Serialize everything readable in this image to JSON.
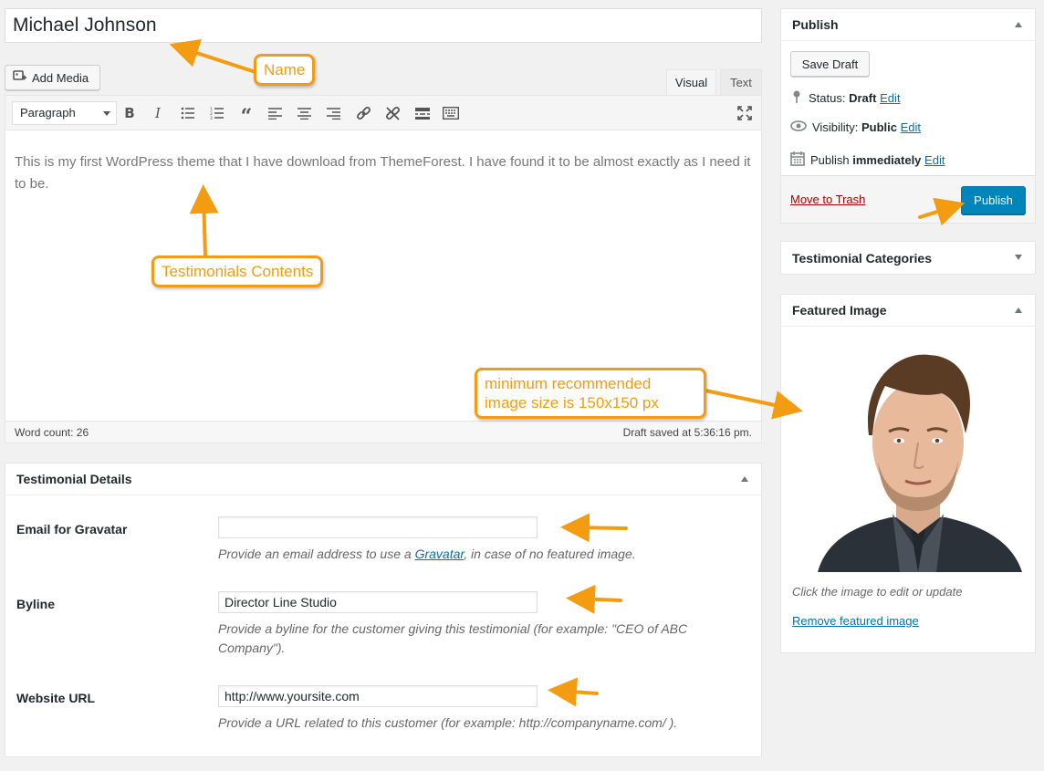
{
  "post": {
    "title": "Michael Johnson",
    "content": "This is my first WordPress theme that I have download from ThemeForest. I have found it to be almost exactly as I need it to be."
  },
  "editor": {
    "add_media_label": "Add Media",
    "tab_visual": "Visual",
    "tab_text": "Text",
    "format_select_value": "Paragraph",
    "toolbar_icons": [
      "bold-icon",
      "italic-icon",
      "bulleted-list-icon",
      "numbered-list-icon",
      "blockquote-icon",
      "align-left-icon",
      "align-center-icon",
      "align-right-icon",
      "link-icon",
      "unlink-icon",
      "read-more-icon",
      "toolbar-toggle-icon",
      "fullscreen-icon"
    ],
    "word_count": "Word count: 26",
    "draft_saved": "Draft saved at 5:36:16 pm."
  },
  "details": {
    "title": "Testimonial Details",
    "email_label": "Email for Gravatar",
    "email_value": "",
    "email_desc_before": "Provide an email address to use a ",
    "email_desc_link": "Gravatar",
    "email_desc_after": ", in case of no featured image.",
    "byline_label": "Byline",
    "byline_value": "Director Line Studio",
    "byline_desc": "Provide a byline for the customer giving this testimonial (for example: \"CEO of ABC Company\").",
    "url_label": "Website URL",
    "url_value": "http://www.yoursite.com",
    "url_desc": "Provide a URL related to this customer (for example: http://companyname.com/ )."
  },
  "publish": {
    "title": "Publish",
    "save_draft": "Save Draft",
    "status_label": "Status:",
    "status_value": "Draft",
    "visibility_label": "Visibility:",
    "visibility_value": "Public",
    "publish_label": "Publish",
    "publish_value": "immediately",
    "edit": "Edit",
    "trash": "Move to Trash",
    "publish_button": "Publish"
  },
  "categories": {
    "title": "Testimonial Categories"
  },
  "featured": {
    "title": "Featured Image",
    "hint": "Click the image to edit or update",
    "remove": "Remove featured image"
  },
  "annotations": {
    "name": "Name",
    "contents": "Testimonials Contents",
    "image_size_line1": "minimum recommended",
    "image_size_line2": "image size is 150x150 px"
  },
  "colors": {
    "accent": "#0085ba",
    "annotation": "#f39c12",
    "trash": "#aa0000"
  }
}
